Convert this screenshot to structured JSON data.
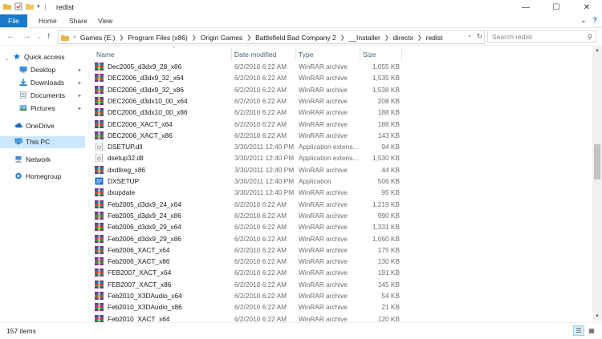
{
  "window": {
    "title": "redist"
  },
  "ribbon": {
    "tabs": [
      "File",
      "Home",
      "Share",
      "View"
    ]
  },
  "address": {
    "crumbs": [
      "Games (E:)",
      "Program Files (x86)",
      "Origin Games",
      "Battlefield Bad Company 2",
      "__Installer",
      "directx",
      "redist"
    ],
    "search_placeholder": "Search redist"
  },
  "sidebar": {
    "items": [
      {
        "label": "Quick access",
        "icon": "star-icon"
      },
      {
        "label": "Desktop",
        "icon": "folder-icon"
      },
      {
        "label": "Downloads",
        "icon": "download-icon"
      },
      {
        "label": "Documents",
        "icon": "document-icon"
      },
      {
        "label": "Pictures",
        "icon": "picture-icon"
      },
      {
        "label": "OneDrive",
        "icon": "cloud-icon"
      },
      {
        "label": "This PC",
        "icon": "computer-icon"
      },
      {
        "label": "Network",
        "icon": "network-icon"
      },
      {
        "label": "Homegroup",
        "icon": "homegroup-icon"
      }
    ]
  },
  "columns": {
    "name": "Name",
    "date": "Date modified",
    "type": "Type",
    "size": "Size"
  },
  "files": [
    {
      "name": "Dec2005_d3dx9_28_x86",
      "date": "6/2/2010 6:22 AM",
      "type": "WinRAR archive",
      "size": "1,055 KB",
      "icon": "rar"
    },
    {
      "name": "DEC2006_d3dx9_32_x64",
      "date": "6/2/2010 6:22 AM",
      "type": "WinRAR archive",
      "size": "1,535 KB",
      "icon": "rar"
    },
    {
      "name": "DEC2006_d3dx9_32_x86",
      "date": "6/2/2010 6:22 AM",
      "type": "WinRAR archive",
      "size": "1,538 KB",
      "icon": "rar"
    },
    {
      "name": "DEC2006_d3dx10_00_x64",
      "date": "6/2/2010 6:22 AM",
      "type": "WinRAR archive",
      "size": "208 KB",
      "icon": "rar"
    },
    {
      "name": "DEC2006_d3dx10_00_x86",
      "date": "6/2/2010 6:22 AM",
      "type": "WinRAR archive",
      "size": "188 KB",
      "icon": "rar"
    },
    {
      "name": "DEC2006_XACT_x64",
      "date": "6/2/2010 6:22 AM",
      "type": "WinRAR archive",
      "size": "188 KB",
      "icon": "rar"
    },
    {
      "name": "DEC2006_XACT_x86",
      "date": "6/2/2010 6:22 AM",
      "type": "WinRAR archive",
      "size": "143 KB",
      "icon": "rar"
    },
    {
      "name": "DSETUP.dll",
      "date": "3/30/2011 12:40 PM",
      "type": "Application extens...",
      "size": "94 KB",
      "icon": "dll"
    },
    {
      "name": "dsetup32.dll",
      "date": "3/30/2011 12:40 PM",
      "type": "Application extens...",
      "size": "1,530 KB",
      "icon": "dll"
    },
    {
      "name": "dxdllreg_x86",
      "date": "3/30/2011 12:40 PM",
      "type": "WinRAR archive",
      "size": "44 KB",
      "icon": "rar"
    },
    {
      "name": "DXSETUP",
      "date": "3/30/2011 12:40 PM",
      "type": "Application",
      "size": "506 KB",
      "icon": "exe"
    },
    {
      "name": "dxupdate",
      "date": "3/30/2011 12:40 PM",
      "type": "WinRAR archive",
      "size": "95 KB",
      "icon": "rar"
    },
    {
      "name": "Feb2005_d3dx9_24_x64",
      "date": "6/2/2010 6:22 AM",
      "type": "WinRAR archive",
      "size": "1,219 KB",
      "icon": "rar"
    },
    {
      "name": "Feb2005_d3dx9_24_x86",
      "date": "6/2/2010 6:22 AM",
      "type": "WinRAR archive",
      "size": "990 KB",
      "icon": "rar"
    },
    {
      "name": "Feb2006_d3dx9_29_x64",
      "date": "6/2/2010 6:22 AM",
      "type": "WinRAR archive",
      "size": "1,331 KB",
      "icon": "rar"
    },
    {
      "name": "Feb2006_d3dx9_29_x86",
      "date": "6/2/2010 6:22 AM",
      "type": "WinRAR archive",
      "size": "1,060 KB",
      "icon": "rar"
    },
    {
      "name": "Feb2006_XACT_x64",
      "date": "6/2/2010 6:22 AM",
      "type": "WinRAR archive",
      "size": "175 KB",
      "icon": "rar"
    },
    {
      "name": "Feb2006_XACT_x86",
      "date": "6/2/2010 6:22 AM",
      "type": "WinRAR archive",
      "size": "130 KB",
      "icon": "rar"
    },
    {
      "name": "FEB2007_XACT_x64",
      "date": "6/2/2010 6:22 AM",
      "type": "WinRAR archive",
      "size": "191 KB",
      "icon": "rar"
    },
    {
      "name": "FEB2007_XACT_x86",
      "date": "6/2/2010 6:22 AM",
      "type": "WinRAR archive",
      "size": "145 KB",
      "icon": "rar"
    },
    {
      "name": "Feb2010_X3DAudio_x64",
      "date": "6/2/2010 6:22 AM",
      "type": "WinRAR archive",
      "size": "54 KB",
      "icon": "rar"
    },
    {
      "name": "Feb2010_X3DAudio_x86",
      "date": "6/2/2010 6:22 AM",
      "type": "WinRAR archive",
      "size": "21 KB",
      "icon": "rar"
    },
    {
      "name": "Feb2010_XACT_x64",
      "date": "6/2/2010 6:22 AM",
      "type": "WinRAR archive",
      "size": "120 KB",
      "icon": "rar"
    }
  ],
  "status": {
    "item_count": "157 items"
  },
  "colors": {
    "accent": "#1979ca",
    "selection": "#cce8ff",
    "header_text": "#4c607a"
  }
}
